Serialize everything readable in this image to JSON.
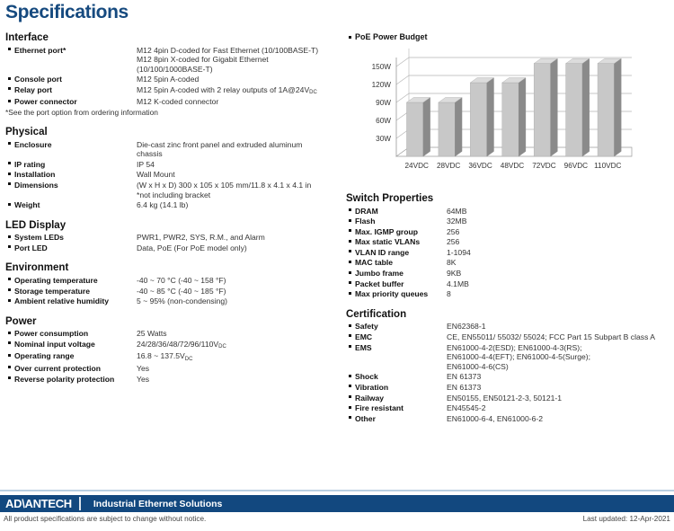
{
  "page_title": "Specifications",
  "colors": {
    "title_blue": "#164a7f",
    "footer_navy": "#12487f",
    "rule_blue": "#b9cfe2",
    "bar_face": "#c8c8c8",
    "bar_side": "#8a8a8a"
  },
  "left_sections": [
    {
      "title": "Interface",
      "rows": [
        {
          "label": "Ethernet port*",
          "lines": [
            "M12 4pin D-coded for Fast Ethernet (10/100BASE-T)",
            "M12 8pin X-coded for Gigabit Ethernet",
            "(10/100/1000BASE-T)"
          ]
        },
        {
          "label": "Console port",
          "lines": [
            "M12 5pin A-coded"
          ]
        },
        {
          "label": "Relay port",
          "lines": [
            "M12 5pin A-coded with 2 relay outputs of 1A@24V<sub>DC</sub>"
          ]
        },
        {
          "label": "Power connector",
          "lines": [
            "M12 K-coded connector"
          ]
        }
      ],
      "footnote": "*See the port option from ordering information"
    },
    {
      "title": "Physical",
      "rows": [
        {
          "label": "Enclosure",
          "lines": [
            "Die-cast zinc front panel and extruded aluminum",
            "chassis"
          ]
        },
        {
          "label": "IP rating",
          "lines": [
            "IP 54"
          ]
        },
        {
          "label": "Installation",
          "lines": [
            "Wall Mount"
          ]
        },
        {
          "label": "Dimensions",
          "lines": [
            "(W x H x D) 300 x 105 x 105 mm/11.8 x 4.1 x 4.1 in",
            "*not including bracket"
          ]
        },
        {
          "label": "Weight",
          "lines": [
            "6.4 kg (14.1 lb)"
          ]
        }
      ]
    },
    {
      "title": "LED Display",
      "rows": [
        {
          "label": "System LEDs",
          "lines": [
            "PWR1, PWR2, SYS, R.M., and Alarm"
          ]
        },
        {
          "label": "Port LED",
          "lines": [
            "Data, PoE (For PoE model only)"
          ]
        }
      ]
    },
    {
      "title": "Environment",
      "rows": [
        {
          "label": "Operating temperature",
          "lines": [
            "-40 ~ 70 °C (-40 ~ 158 °F)"
          ]
        },
        {
          "label": "Storage temperature",
          "lines": [
            "-40 ~ 85 °C (-40 ~ 185 °F)"
          ]
        },
        {
          "label": "Ambient relative humidity",
          "lines": [
            "5 ~ 95% (non-condensing)"
          ]
        }
      ]
    },
    {
      "title": "Power",
      "rows": [
        {
          "label": "Power consumption",
          "lines": [
            "25 Watts"
          ]
        },
        {
          "label": "Nominal input voltage",
          "lines": [
            "24/28/36/48/72/96/110V<sub>DC</sub>"
          ]
        },
        {
          "label": "Operating range",
          "lines": [
            "16.8 ~ 137.5V<sub>DC</sub>"
          ]
        },
        {
          "label": "Over current protection",
          "lines": [
            "Yes"
          ]
        },
        {
          "label": "Reverse polarity protection",
          "lines": [
            "Yes"
          ]
        }
      ]
    }
  ],
  "chart_title": "PoE Power Budget",
  "chart_data": {
    "type": "bar",
    "title": "PoE Power Budget",
    "categories": [
      "24VDC",
      "28VDC",
      "36VDC",
      "48VDC",
      "72VDC",
      "96VDC",
      "110VDC"
    ],
    "values": [
      90,
      90,
      123,
      123,
      155,
      155,
      155
    ],
    "ytick_labels": [
      "30W",
      "60W",
      "90W",
      "120W",
      "150W"
    ],
    "yticks": [
      30,
      60,
      90,
      120,
      150
    ],
    "ylim": [
      0,
      165
    ],
    "xlabel": "",
    "ylabel": "",
    "grid": true,
    "legend": "none",
    "style": "3d-column"
  },
  "right_sections": [
    {
      "title": "Switch Properties",
      "rows": [
        {
          "label": "DRAM",
          "lines": [
            "64MB"
          ]
        },
        {
          "label": "Flash",
          "lines": [
            "32MB"
          ]
        },
        {
          "label": "Max. IGMP group",
          "lines": [
            "256"
          ]
        },
        {
          "label": "Max static VLANs",
          "lines": [
            "256"
          ]
        },
        {
          "label": "VLAN ID range",
          "lines": [
            "1-1094"
          ]
        },
        {
          "label": "MAC table",
          "lines": [
            "8K"
          ]
        },
        {
          "label": "Jumbo frame",
          "lines": [
            "9KB"
          ]
        },
        {
          "label": "Packet buffer",
          "lines": [
            "4.1MB"
          ]
        },
        {
          "label": "Max priority queues",
          "lines": [
            "8"
          ]
        }
      ]
    },
    {
      "title": "Certification",
      "rows": [
        {
          "label": "Safety",
          "lines": [
            "EN62368-1"
          ]
        },
        {
          "label": "EMC",
          "lines": [
            "CE, EN55011/ 55032/ 55024; FCC Part 15 Subpart B class A"
          ]
        },
        {
          "label": "EMS",
          "lines": [
            "EN61000-4-2(ESD); EN61000-4-3(RS);",
            "EN61000-4-4(EFT); EN61000-4-5(Surge);",
            "EN61000-4-6(CS)"
          ]
        },
        {
          "label": "Shock",
          "lines": [
            "EN 61373"
          ]
        },
        {
          "label": "Vibration",
          "lines": [
            "EN 61373"
          ]
        },
        {
          "label": "Railway",
          "lines": [
            "EN50155, EN50121-2-3, 50121-1"
          ]
        },
        {
          "label": "Fire resistant",
          "lines": [
            "EN45545-2"
          ]
        },
        {
          "label": "Other",
          "lines": [
            "EN61000-6-4, EN61000-6-2"
          ]
        }
      ]
    }
  ],
  "footer": {
    "logo_pre": "AD",
    "logo_slash": "\\",
    "logo_post": "ANTECH",
    "tagline": "Industrial Ethernet Solutions",
    "disclaimer": "All product specifications are subject to change without notice.",
    "last_updated": "Last updated: 12-Apr-2021"
  }
}
